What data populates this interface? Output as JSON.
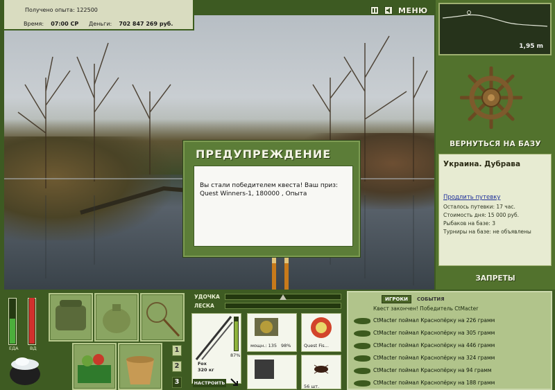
{
  "info": {
    "exp_label": "Получено опыта:",
    "exp_value": "122500",
    "time_label": "Время:",
    "time_value": "07:00 СР",
    "money_label": "Деньги:",
    "money_value": "702 847 269 руб."
  },
  "top": {
    "menu_label": "МЕНЮ"
  },
  "depth": {
    "value": "1,95 m"
  },
  "base": {
    "return_label": "ВЕРНУТЬСЯ НА БАЗУ",
    "name": "Украина. Дубрава",
    "extend_link": "Продлить путевку",
    "lines": [
      "Осталось путевки: 17 час.",
      "Стоимость дня: 15 000 руб.",
      "Рыбаков на базе: 3",
      "Турниры на базе: не объявлены"
    ],
    "bans_label": "ЗАПРЕТЫ"
  },
  "dialog": {
    "title": "ПРЕДУПРЕЖДЕНИЕ",
    "text_line1": "Вы стали победителем квеста! Ваш приз:",
    "text_line2": "Quest Winners-1, 180000 , Опыта"
  },
  "bottom": {
    "food_label": "ЕДА",
    "food_level": 0.55,
    "water_label": "ВД",
    "water_level": 1.0,
    "pages": [
      "1",
      "2",
      "3"
    ],
    "active_page": "3",
    "rod_label": "УДОЧКА",
    "line_label": "ЛЕСКА",
    "rod_name": "Fox",
    "rod_load": "320 кг",
    "rod_percent": "87%",
    "reel_power": "мощн.: 135",
    "reel_percent": "98%",
    "line_name": "Quest Fis...",
    "bait_count": "56 шт.",
    "setup_label": "НАСТРОИТЬ"
  },
  "events": {
    "tab_players": "ИГРОКИ",
    "tab_events": "СОБЫТИЯ",
    "first": "Квест закончен! Победитель CtMacter",
    "items": [
      "CtMacter поймал Краснопёрку на 226 грамм",
      "CtMacter поймал Краснопёрку на 305 грамм",
      "CtMacter поймал Краснопёрку на 446 грамм",
      "CtMacter поймал Краснопёрку на 324 грамм",
      "CtMacter поймал Краснопёрку на 94 грамм",
      "CtMacter поймал Краснопёрку на 188 грамм"
    ]
  },
  "colors": {
    "frame_green": "#3e5b22",
    "panel_green": "#52722d",
    "light_panel": "#e7ebd2",
    "link_blue": "#1e2f9a",
    "food_fill": "#4caf3c",
    "water_fill": "#d0312d"
  }
}
